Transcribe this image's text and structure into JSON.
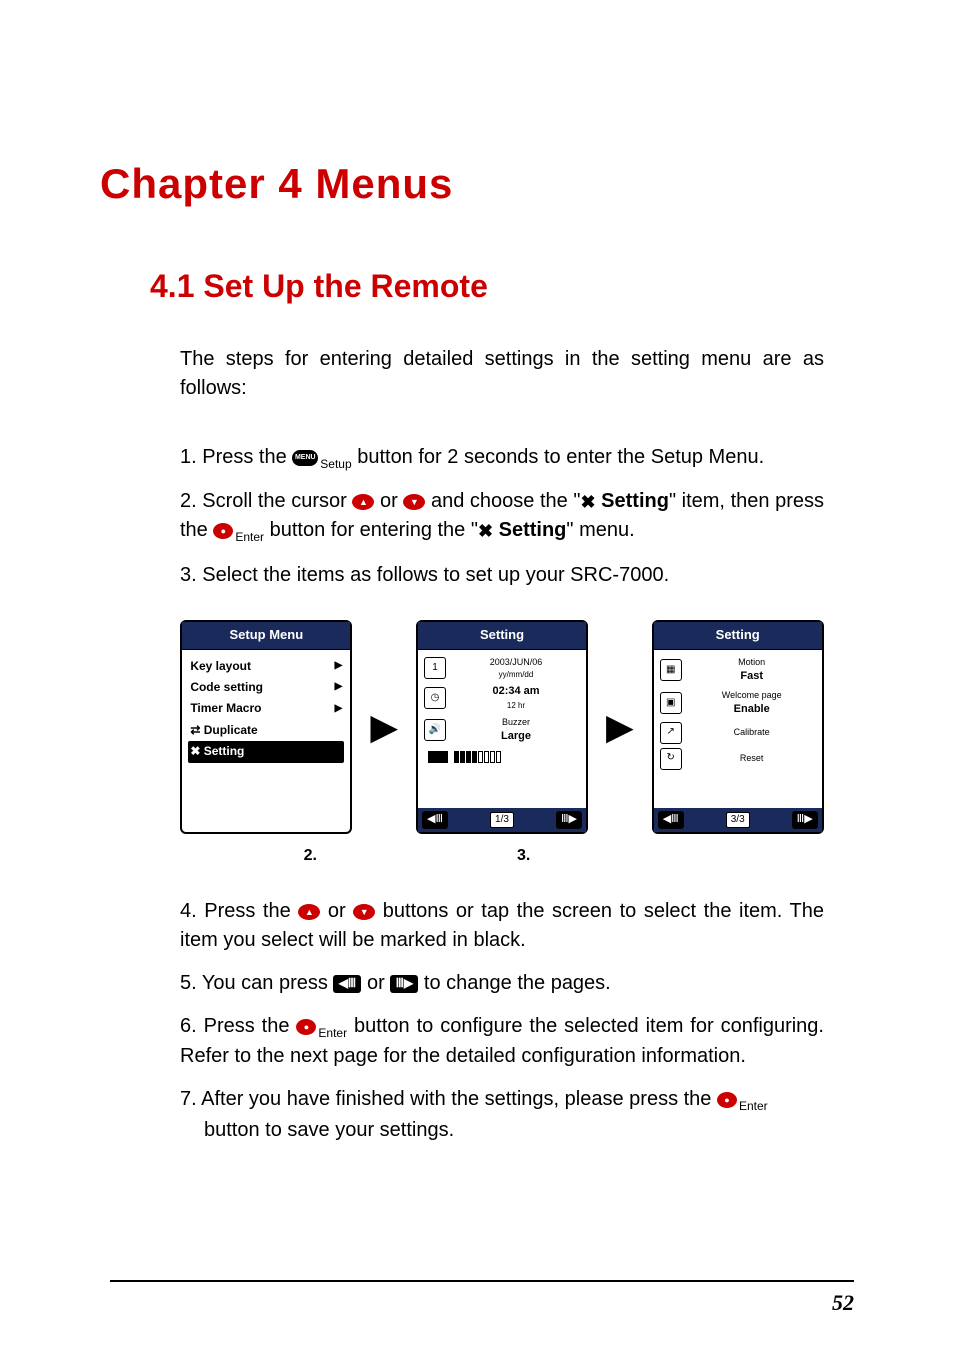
{
  "chapterTitle": "Chapter 4  Menus",
  "sectionTitle": "4.1 Set Up the Remote",
  "intro": "The steps for entering detailed settings in the setting menu are as follows:",
  "steps": {
    "s1_a": "1. Press the ",
    "s1_setup": "Setup",
    "s1_b": " button for 2 seconds to enter the Setup Menu.",
    "s2_a": "2. Scroll the cursor ",
    "s2_or": " or ",
    "s2_b": " and choose the \"",
    "s2_setting1": " Setting",
    "s2_c": "\" item, then press the ",
    "s2_enter": "Enter",
    "s2_d": " button for entering the \"",
    "s2_setting2": " Setting",
    "s2_e": "\" menu.",
    "s3": "3. Select the items as follows to set up your SRC-7000.",
    "s4_a": "4. Press the ",
    "s4_or": " or ",
    "s4_b": " buttons or tap the screen to select the item. The item you select will be marked in black.",
    "s5_a": "5. You can press ",
    "s5_or": " or ",
    "s5_b": " to change the pages.",
    "s6_a": "6. Press the ",
    "s6_enter": "Enter",
    "s6_b": " button to configure the selected item for configuring. Refer to the next page for the detailed configuration information.",
    "s7_a": "7. After you have finished with the settings, please press the ",
    "s7_enter": "Enter",
    "s7_b": "button to save your settings."
  },
  "screen1": {
    "header": "Setup Menu",
    "items": [
      "Key layout",
      "Code setting",
      "Timer Macro",
      "Duplicate",
      "Setting"
    ]
  },
  "screen2": {
    "header": "Setting",
    "date": "2003/JUN/06",
    "dateFmt": "yy/mm/dd",
    "time": "02:34 am",
    "timeFmt": "12 hr",
    "buzzerTop": "Buzzer",
    "buzzer": "Large",
    "pager": "1/3"
  },
  "screen3": {
    "header": "Setting",
    "motionTop": "Motion",
    "motion": "Fast",
    "welcomeTop": "Welcome page",
    "welcome": "Enable",
    "calibrate": "Calibrate",
    "reset": "Reset",
    "pager": "3/3"
  },
  "screenLabels": {
    "l2": "2.",
    "l3": "3."
  },
  "pageNumber": "52"
}
